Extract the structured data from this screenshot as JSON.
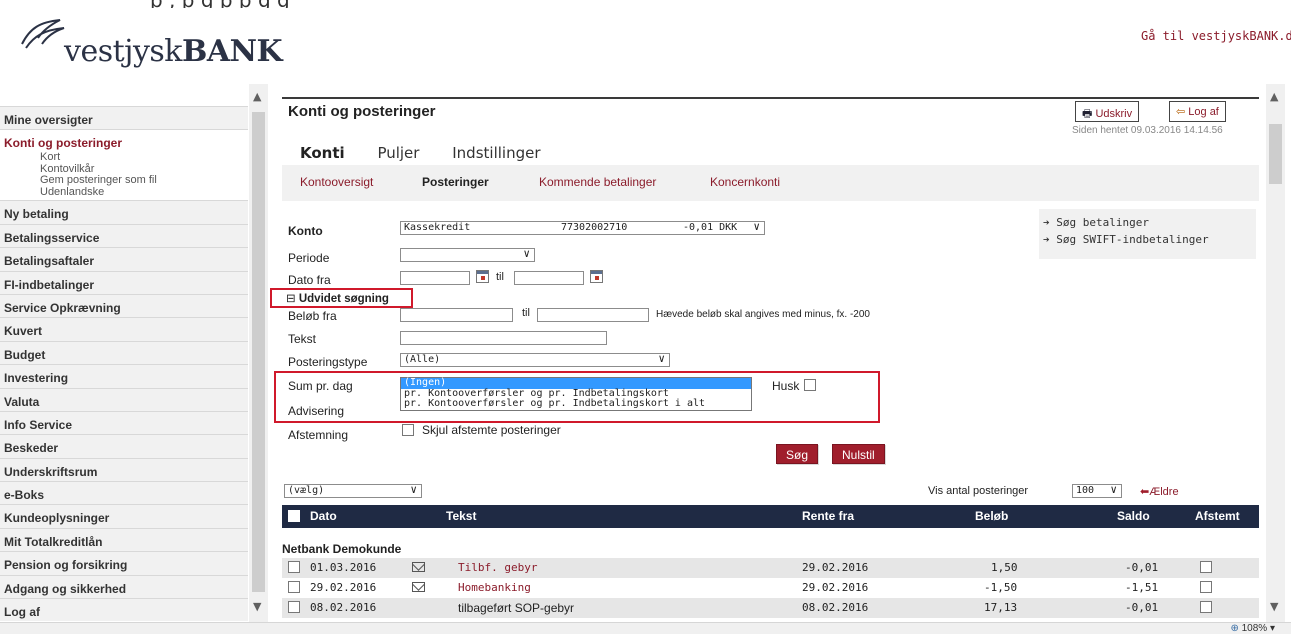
{
  "top_fragment": "p                                    ,                                        p      g   p p              g      g",
  "brand": {
    "word_light": "vestjysk",
    "word_bold": "BANK",
    "goto_link": "Gå til vestjyskBANK.dk",
    "logo_icon": "bird-logo-icon"
  },
  "sidebar": {
    "items": [
      {
        "label": "Mine oversigter"
      },
      {
        "label": "Konti og posteringer",
        "active": true,
        "sub": [
          "Kort",
          "Kontovilkår",
          "Gem posteringer som fil",
          "Udenlandske"
        ]
      },
      {
        "label": "Ny betaling"
      },
      {
        "label": "Betalingsservice"
      },
      {
        "label": "Betalingsaftaler"
      },
      {
        "label": "FI-indbetalinger"
      },
      {
        "label": "Service Opkrævning"
      },
      {
        "label": "Kuvert"
      },
      {
        "label": "Budget"
      },
      {
        "label": "Investering"
      },
      {
        "label": "Valuta"
      },
      {
        "label": "Info Service"
      },
      {
        "label": "Beskeder"
      },
      {
        "label": "Underskriftsrum"
      },
      {
        "label": "e-Boks"
      },
      {
        "label": "Kundeoplysninger"
      },
      {
        "label": "Mit Totalkreditlån"
      },
      {
        "label": "Pension og forsikring"
      },
      {
        "label": "Adgang og sikkerhed"
      },
      {
        "label": "Log af"
      }
    ]
  },
  "header": {
    "title": "Konti og posteringer",
    "print_label": "Udskriv",
    "logout_label": "Log af",
    "fetched": "Siden hentet 09.03.2016 14.14.56"
  },
  "tabs": [
    "Konti",
    "Puljer",
    "Indstillinger"
  ],
  "subnav": [
    "Kontooversigt",
    "Posteringer",
    "Kommende betalinger",
    "Koncernkonti"
  ],
  "form": {
    "konto_label": "Konto",
    "konto_name": "Kassekredit",
    "konto_number": "77302002710",
    "konto_balance": "-0,01 DKK",
    "periode_label": "Periode",
    "dato_fra_label": "Dato fra",
    "til": "til",
    "udvidet_label": "Udvidet søgning",
    "beloeb_fra_label": "Beløb fra",
    "beloeb_hint": "Hævede beløb skal angives med minus, fx. -200",
    "tekst_label": "Tekst",
    "posteringstype_label": "Posteringstype",
    "posteringstype_value": "(Alle)",
    "sum_label": "Sum pr. dag",
    "sum_options": [
      "(Ingen)",
      "pr. Kontooverførsler og pr. Indbetalingskort",
      "pr. Kontooverførsler og pr. Indbetalingskort i alt"
    ],
    "husk_label": "Husk",
    "advisering_label": "Advisering",
    "afstemning_label": "Afstemning",
    "skjul_label": "Skjul afstemte posteringer",
    "search_btn": "Søg",
    "reset_btn": "Nulstil"
  },
  "side_links": [
    "Søg betalinger",
    "Søg SWIFT-indbetalinger"
  ],
  "list_controls": {
    "action_select": "(vælg)",
    "count_label": "Vis antal posteringer",
    "count_value": "100",
    "older_label": "Ældre"
  },
  "table": {
    "headers": [
      "Dato",
      "Tekst",
      "Rente fra",
      "Beløb",
      "Saldo",
      "Afstemt"
    ],
    "group": "Netbank Demokunde",
    "rows": [
      {
        "date": "01.03.2016",
        "text": "Tilbf. gebyr",
        "rente_fra": "29.02.2016",
        "amount": "1,50",
        "saldo": "-0,01",
        "has_mail": true,
        "link": true
      },
      {
        "date": "29.02.2016",
        "text": "Homebanking",
        "rente_fra": "29.02.2016",
        "amount": "-1,50",
        "saldo": "-1,51",
        "has_mail": true,
        "link": true
      },
      {
        "date": "08.02.2016",
        "text": "tilbageført SOP-gebyr",
        "rente_fra": "08.02.2016",
        "amount": "17,13",
        "saldo": "-0,01",
        "has_mail": false,
        "link": false
      }
    ]
  },
  "zoom": "108%",
  "colors": {
    "brand_red": "#8b1c2b",
    "button_red": "#a01e2c",
    "table_header": "#1f2a44",
    "highlight_red": "#d0192b"
  }
}
